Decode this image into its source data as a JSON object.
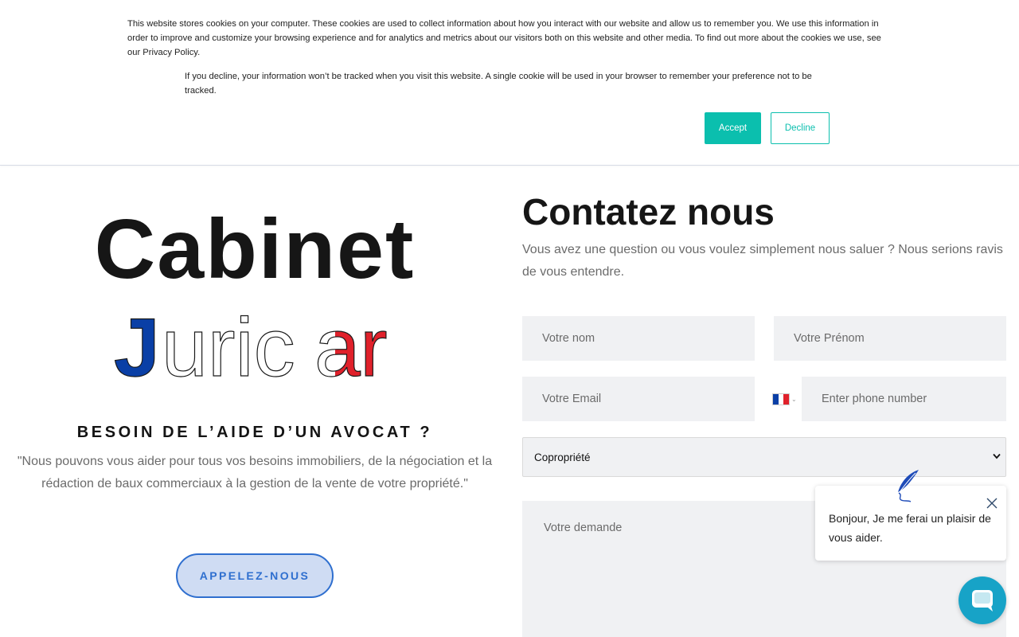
{
  "cookie_banner": {
    "text1": "This website stores cookies on your computer. These cookies are used to collect information about how you interact with our website and allow us to remember you. We use this information in order to improve and customize your browsing experience and for analytics and metrics about our visitors both on this website and other media. To find out more about the cookies we use, see our Privacy Policy.",
    "text2": "If you decline, your information won’t be tracked when you visit this website. A single cookie will be used in your browser to remember your preference not to be tracked.",
    "accept_label": "Accept",
    "decline_label": "Decline"
  },
  "brand": {
    "line1": "Cabinet",
    "line2": "Juricar",
    "colors": {
      "blue": "#0a3fa6",
      "red": "#e0212b",
      "white_outline": "#1a1a1a"
    }
  },
  "hero": {
    "title": "BESOIN DE L’AIDE D’UN AVOCAT ?",
    "quote": "\"Nous pouvons vous aider pour tous vos besoins immobiliers, de la négociation et la rédaction de baux commerciaux à la gestion de la vente de votre propriété.\"",
    "call_button": "APPELEZ-NOUS"
  },
  "contact_form": {
    "title": "Contatez nous",
    "intro": "Vous avez une question ou vous voulez simplement nous saluer ? Nous serions ravis de vous entendre.",
    "name_placeholder": "Votre nom",
    "firstname_placeholder": "Votre Prénom",
    "email_placeholder": "Votre Email",
    "phone_placeholder": "Enter phone number",
    "phone_country": "France",
    "subject_selected": "Copropriété",
    "message_placeholder": "Votre demande"
  },
  "chat": {
    "message": "Bonjour, Je me ferai un plaisir de vous aider.",
    "accent_color": "#17a3c7"
  }
}
